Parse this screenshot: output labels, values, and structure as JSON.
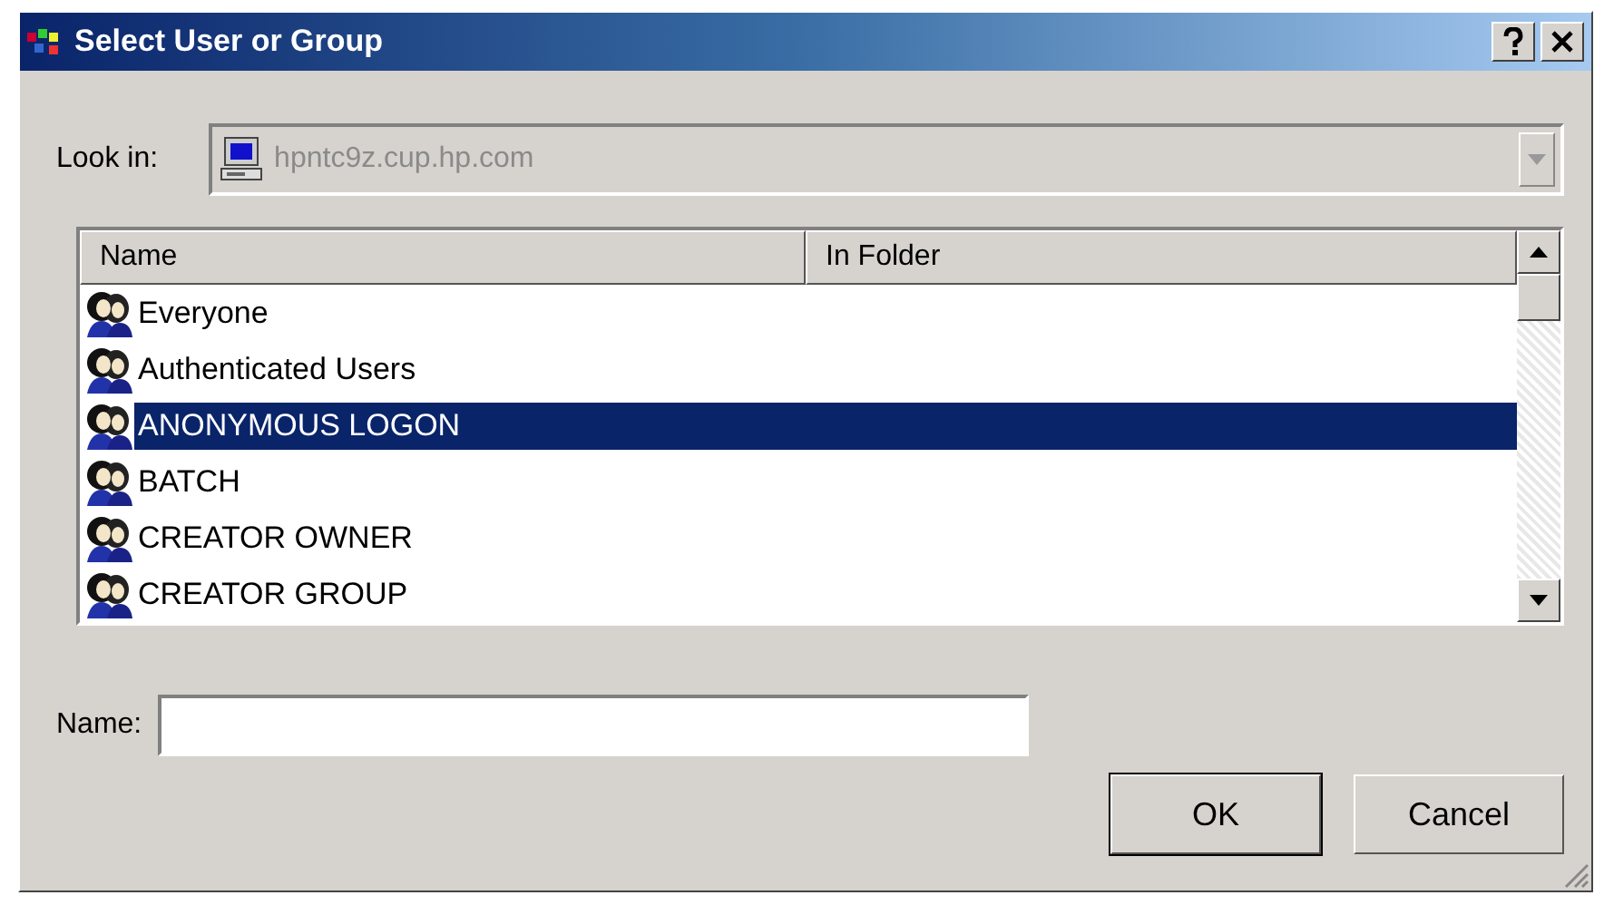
{
  "window": {
    "title": "Select User or Group"
  },
  "look_in": {
    "label": "Look in:",
    "value": "hpntc9z.cup.hp.com",
    "disabled": true
  },
  "list": {
    "columns": [
      "Name",
      "In Folder"
    ],
    "rows": [
      {
        "name": "Everyone",
        "selected": false
      },
      {
        "name": "Authenticated Users",
        "selected": false
      },
      {
        "name": "ANONYMOUS LOGON",
        "selected": true
      },
      {
        "name": "BATCH",
        "selected": false
      },
      {
        "name": "CREATOR OWNER",
        "selected": false
      },
      {
        "name": "CREATOR GROUP",
        "selected": false
      }
    ]
  },
  "name_field": {
    "label": "Name:"
  },
  "buttons": [
    {
      "label": "OK",
      "default": true
    },
    {
      "label": "Cancel",
      "default": false
    }
  ]
}
